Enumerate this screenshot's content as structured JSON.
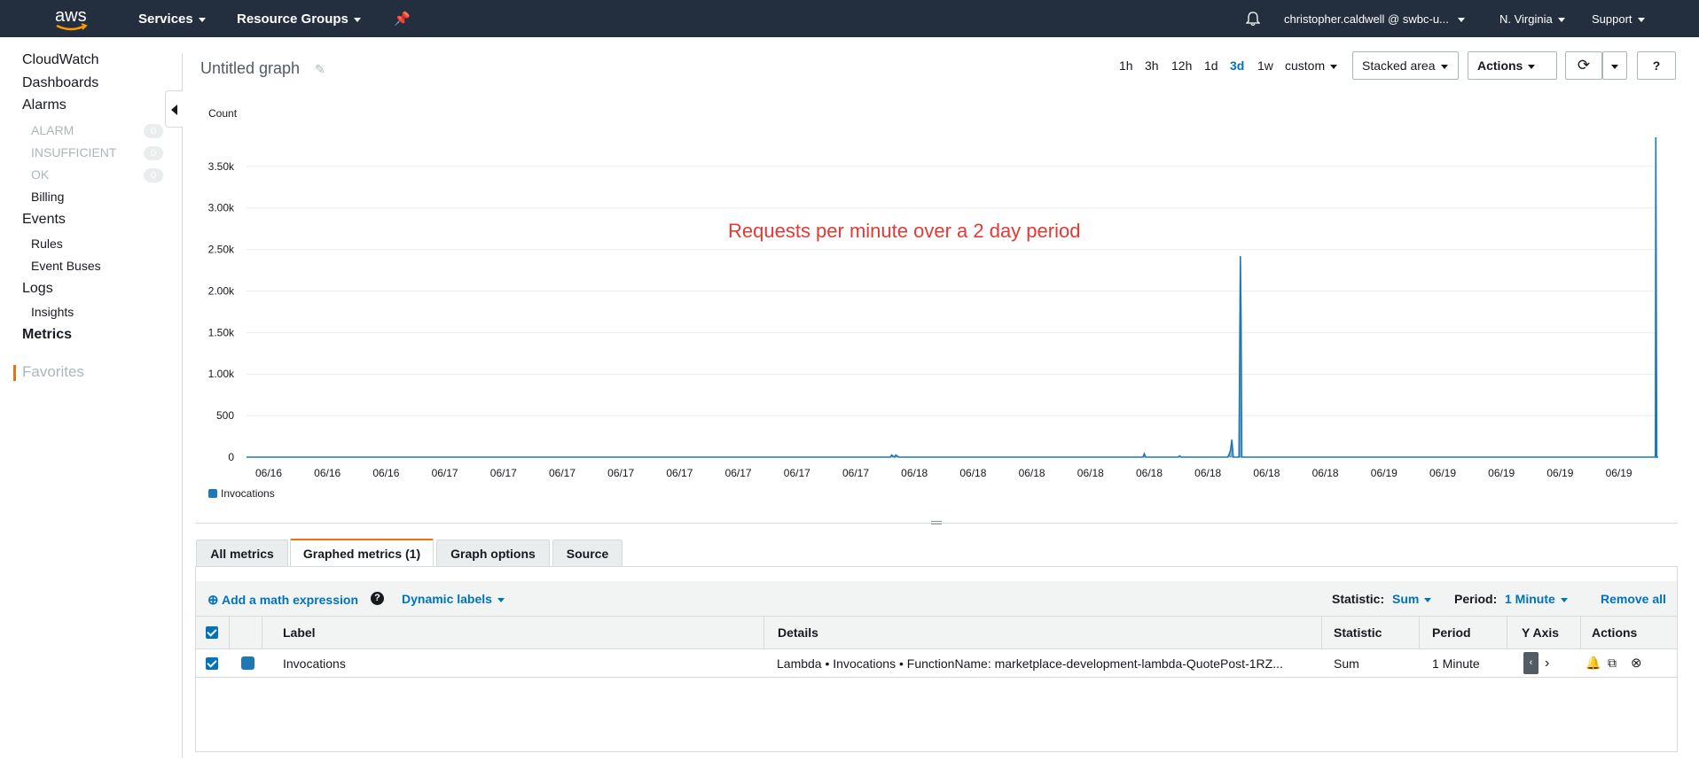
{
  "topbar": {
    "logo": "aws",
    "services": "Services",
    "resource_groups": "Resource Groups",
    "pin_icon": "pin-icon",
    "bell_icon": "bell-icon",
    "account": "christopher.caldwell @ swbc-u...",
    "region": "N. Virginia",
    "support": "Support"
  },
  "sidebar": {
    "cloudwatch": "CloudWatch",
    "dashboards": "Dashboards",
    "alarms": "Alarms",
    "alarm_states": [
      {
        "label": "ALARM",
        "count": "0"
      },
      {
        "label": "INSUFFICIENT",
        "count": "0"
      },
      {
        "label": "OK",
        "count": "0"
      }
    ],
    "billing": "Billing",
    "events": "Events",
    "rules": "Rules",
    "event_buses": "Event Buses",
    "logs": "Logs",
    "insights": "Insights",
    "metrics": "Metrics",
    "favorites": "Favorites"
  },
  "graph": {
    "title": "Untitled graph",
    "time_ranges": [
      "1h",
      "3h",
      "12h",
      "1d",
      "3d",
      "1w"
    ],
    "selected_range": "3d",
    "custom": "custom",
    "view_type": "Stacked area",
    "actions": "Actions",
    "refresh_icon": "refresh-icon",
    "help_icon": "help-icon",
    "annotation": "Requests per minute over a 2 day period"
  },
  "chart_data": {
    "type": "area",
    "ylabel": "Count",
    "yticks": [
      "0",
      "500",
      "1.00k",
      "1.50k",
      "2.00k",
      "2.50k",
      "3.00k",
      "3.50k"
    ],
    "ylim": [
      0,
      3850
    ],
    "xticks": [
      "06/16",
      "06/16",
      "06/16",
      "06/17",
      "06/17",
      "06/17",
      "06/17",
      "06/17",
      "06/17",
      "06/17",
      "06/17",
      "06/18",
      "06/18",
      "06/18",
      "06/18",
      "06/18",
      "06/18",
      "06/18",
      "06/18",
      "06/19",
      "06/19",
      "06/19",
      "06/19",
      "06/19"
    ],
    "legend": "Invocations",
    "color": "#1f77b4",
    "grid": true,
    "x_index_range": [
      0,
      1000
    ],
    "series": [
      {
        "name": "Invocations",
        "points": [
          [
            0,
            0
          ],
          [
            456,
            0
          ],
          [
            457,
            25
          ],
          [
            459,
            0
          ],
          [
            460,
            25
          ],
          [
            462,
            0
          ],
          [
            635,
            0
          ],
          [
            636,
            40
          ],
          [
            637,
            0
          ],
          [
            660,
            0
          ],
          [
            661,
            15
          ],
          [
            662,
            0
          ],
          [
            695,
            0
          ],
          [
            696,
            30
          ],
          [
            697,
            80
          ],
          [
            698,
            210
          ],
          [
            699,
            0
          ],
          [
            703,
            0
          ],
          [
            704,
            2420
          ],
          [
            704.5,
            1650
          ],
          [
            705,
            0
          ],
          [
            998,
            0
          ],
          [
            998.3,
            3850
          ],
          [
            998.6,
            2000
          ],
          [
            999,
            0
          ],
          [
            1000,
            0
          ]
        ]
      }
    ]
  },
  "tabs": [
    "All metrics",
    "Graphed metrics (1)",
    "Graph options",
    "Source"
  ],
  "active_tab": "Graphed metrics (1)",
  "toolbar": {
    "add_math": "Add a math expression",
    "dynamic_labels": "Dynamic labels",
    "statistic_label": "Statistic:",
    "statistic_value": "Sum",
    "period_label": "Period:",
    "period_value": "1 Minute",
    "remove_all": "Remove all"
  },
  "table": {
    "headers": [
      "Label",
      "Details",
      "Statistic",
      "Period",
      "Y Axis",
      "Actions"
    ],
    "rows": [
      {
        "label": "Invocations",
        "details": "Lambda • Invocations • FunctionName: marketplace-development-lambda-QuotePost-1RZ...",
        "statistic": "Sum",
        "period": "1 Minute"
      }
    ]
  }
}
